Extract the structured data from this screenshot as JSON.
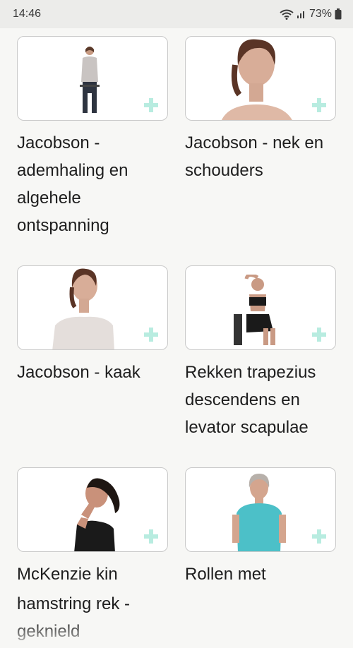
{
  "status_bar": {
    "time": "14:46",
    "battery": "73%"
  },
  "exercises": [
    {
      "title": "Jacobson - ademhaling en algehele ontspanning",
      "image": "seated-woman-full-body"
    },
    {
      "title": "Jacobson - nek en schouders",
      "image": "woman-head-shoulders"
    },
    {
      "title": "Jacobson - kaak",
      "image": "woman-head-shoulders-side"
    },
    {
      "title": "Rekken trapezius descendens en levator scapulae",
      "image": "seated-woman-neck-stretch"
    },
    {
      "title": "McKenzie kin",
      "image": "woman-chin-tuck"
    },
    {
      "title": "Rollen met",
      "image": "woman-shoulder-roll"
    },
    {
      "title": "hamstring rek - geknield",
      "image": ""
    }
  ],
  "colors": {
    "plus_icon": "#b8ece0",
    "card_border": "#c9c9c9",
    "background": "#f7f7f5"
  },
  "icons": {
    "add": "plus-icon",
    "wifi": "wifi-icon",
    "signal": "signal-icon",
    "battery": "battery-icon"
  }
}
